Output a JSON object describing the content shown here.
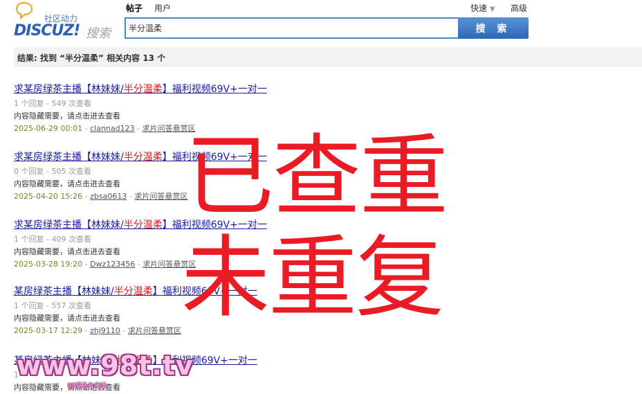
{
  "header": {
    "tagline": "社区动力",
    "brand": "DISCUZ!",
    "brand_search": "搜索",
    "tabs": [
      "帖子",
      "用户"
    ],
    "quick_label": "快速",
    "advanced_label": "高级",
    "accent_color": "#2d67b8"
  },
  "search": {
    "value": "半分温柔",
    "button_label": "搜 索"
  },
  "result_summary": "结果: 找到 “半分温柔” 相关内容 13 个",
  "results": [
    {
      "title_prefix": "求某房绿茶主播【林妹妹/",
      "title_highlight": "半分温柔",
      "title_suffix": "】福利视频69V+一对一",
      "stats": "1 个回复 - 549 次查看",
      "hidden_note": "内容隐藏需要，请点击进去查看",
      "date": "2025-06-29 00:01",
      "author": "clannad123",
      "forum": "求片问答悬赏区"
    },
    {
      "title_prefix": "求某房绿茶主播【林妹妹/",
      "title_highlight": "半分温柔",
      "title_suffix": "】福利视频69V+一对一",
      "stats": "0 个回复 - 505 次查看",
      "hidden_note": "内容隐藏需要，请点击进去查看",
      "date": "2025-04-20 15:26",
      "author": "zbsa0613",
      "forum": "求片问答悬赏区"
    },
    {
      "title_prefix": "求某房绿茶主播【林妹妹/",
      "title_highlight": "半分温柔",
      "title_suffix": "】福利视频69V+一对一",
      "stats": "1 个回复 - 409 次查看",
      "hidden_note": "内容隐藏需要，请点击进去查看",
      "date": "2025-03-28 19:20",
      "author": "Dwz123456",
      "forum": "求片问答悬赏区"
    },
    {
      "title_prefix": "某房绿茶主播【林妹妹/",
      "title_highlight": "半分温柔",
      "title_suffix": "】福利视频69V+一对一",
      "stats": "1 个回复 - 557 次查看",
      "hidden_note": "内容隐藏需要，请点击进去查看",
      "date": "2025-03-17 12:29",
      "author": "zhj9110",
      "forum": "求片问答悬赏区"
    },
    {
      "title_prefix": "某房绿茶主播【林妹妹/",
      "title_highlight": "半分温柔",
      "title_suffix": "】福利视频69V+一对一",
      "stats": "1",
      "hidden_note": "内容隐藏需要，请点击进去查看"
    }
  ],
  "overlay": {
    "stamp_checked": "已查重",
    "stamp_unique": "未重复",
    "stamp_color": "#ea1b24",
    "watermark": "www.98t.tv",
    "watermark_sub": "98堂永久地址"
  }
}
